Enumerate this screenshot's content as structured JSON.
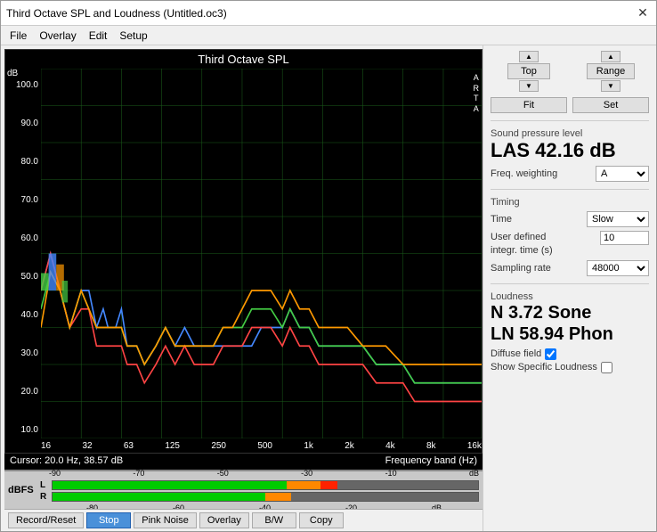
{
  "window": {
    "title": "Third Octave SPL and Loudness (Untitled.oc3)",
    "close_label": "✕"
  },
  "menu": {
    "items": [
      "File",
      "Overlay",
      "Edit",
      "Setup"
    ]
  },
  "chart": {
    "title": "Third Octave SPL",
    "y_title": "dB",
    "arta_label": "A\nR\nT\nA",
    "y_labels": [
      "100.0",
      "90.0",
      "80.0",
      "70.0",
      "60.0",
      "50.0",
      "40.0",
      "30.0",
      "20.0",
      "10.0"
    ],
    "x_labels": [
      "16",
      "32",
      "63",
      "125",
      "250",
      "500",
      "1k",
      "2k",
      "4k",
      "8k",
      "16k"
    ],
    "cursor_info": "Cursor:  20.0 Hz, 38.57 dB",
    "freq_band_label": "Frequency band (Hz)"
  },
  "range_controls": {
    "top_label": "Top",
    "fit_label": "Fit",
    "range_label": "Range",
    "set_label": "Set"
  },
  "spl": {
    "section_label": "Sound pressure level",
    "value": "LAS 42.16 dB",
    "freq_weighting_label": "Freq. weighting",
    "freq_weighting_value": "A"
  },
  "timing": {
    "section_label": "Timing",
    "time_label": "Time",
    "time_value": "Slow",
    "user_defined_label": "User defined\nintegr. time (s)",
    "user_defined_value": "10",
    "sampling_rate_label": "Sampling rate",
    "sampling_rate_value": "48000"
  },
  "loudness": {
    "section_label": "Loudness",
    "n_value": "N 3.72 Sone",
    "ln_value": "LN 58.94 Phon",
    "diffuse_field_label": "Diffuse field",
    "diffuse_field_checked": true,
    "show_specific_label": "Show Specific Loudness",
    "show_specific_checked": false
  },
  "dBFS": {
    "label": "dBFS",
    "l_label": "L",
    "r_label": "R",
    "tick_labels": [
      "-90",
      "-70",
      "-50",
      "-30",
      "-10"
    ],
    "tick_labels_r": [
      "-80",
      "-60",
      "-40",
      "-20"
    ],
    "db_label": "dB",
    "l_fill_pct": 55,
    "r_fill_pct": 50
  },
  "buttons": {
    "record_reset": "Record/Reset",
    "stop": "Stop",
    "pink_noise": "Pink Noise",
    "overlay": "Overlay",
    "bw": "B/W",
    "copy": "Copy"
  }
}
